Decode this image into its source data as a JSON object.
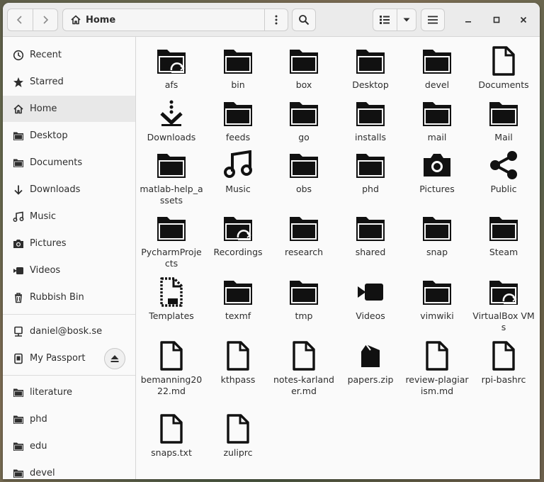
{
  "header": {
    "location": "Home",
    "icons": {
      "back": "chevron-left-icon",
      "forward": "chevron-right-icon",
      "home": "home-icon",
      "menu": "vertical-dots-icon",
      "search": "search-icon",
      "list_view": "list-view-icon",
      "view_options": "chevron-down-icon",
      "main_menu": "hamburger-icon",
      "minimize": "minimize-icon",
      "maximize": "maximize-icon",
      "close": "close-icon"
    }
  },
  "sidebar": {
    "places": [
      {
        "label": "Recent",
        "icon": "clock-icon"
      },
      {
        "label": "Starred",
        "icon": "star-icon"
      },
      {
        "label": "Home",
        "icon": "home-icon",
        "active": true
      },
      {
        "label": "Desktop",
        "icon": "folder-icon"
      },
      {
        "label": "Documents",
        "icon": "folder-icon"
      },
      {
        "label": "Downloads",
        "icon": "download-icon"
      },
      {
        "label": "Music",
        "icon": "music-icon"
      },
      {
        "label": "Pictures",
        "icon": "camera-icon"
      },
      {
        "label": "Videos",
        "icon": "video-icon"
      },
      {
        "label": "Rubbish Bin",
        "icon": "trash-icon"
      }
    ],
    "devices": [
      {
        "label": "daniel@bosk.se",
        "icon": "network-icon"
      },
      {
        "label": "My Passport",
        "icon": "drive-icon",
        "eject": true
      }
    ],
    "bookmarks": [
      {
        "label": "literature",
        "icon": "folder-icon"
      },
      {
        "label": "phd",
        "icon": "folder-icon"
      },
      {
        "label": "edu",
        "icon": "folder-icon"
      },
      {
        "label": "devel",
        "icon": "folder-icon"
      }
    ]
  },
  "files": [
    {
      "name": "afs",
      "icon": "folder-remote-icon"
    },
    {
      "name": "bin",
      "icon": "folder-icon"
    },
    {
      "name": "box",
      "icon": "folder-icon"
    },
    {
      "name": "Desktop",
      "icon": "folder-icon"
    },
    {
      "name": "devel",
      "icon": "folder-icon"
    },
    {
      "name": "Documents",
      "icon": "document-icon"
    },
    {
      "name": "Downloads",
      "icon": "download-icon"
    },
    {
      "name": "feeds",
      "icon": "folder-icon"
    },
    {
      "name": "go",
      "icon": "folder-icon"
    },
    {
      "name": "installs",
      "icon": "folder-icon"
    },
    {
      "name": "mail",
      "icon": "folder-icon"
    },
    {
      "name": "Mail",
      "icon": "folder-icon"
    },
    {
      "name": "matlab-help_assets",
      "icon": "folder-icon"
    },
    {
      "name": "Music",
      "icon": "music-icon"
    },
    {
      "name": "obs",
      "icon": "folder-icon"
    },
    {
      "name": "phd",
      "icon": "folder-icon"
    },
    {
      "name": "Pictures",
      "icon": "camera-icon"
    },
    {
      "name": "Public",
      "icon": "share-icon"
    },
    {
      "name": "PycharmProjects",
      "icon": "folder-icon"
    },
    {
      "name": "Recordings",
      "icon": "folder-remote-icon"
    },
    {
      "name": "research",
      "icon": "folder-icon"
    },
    {
      "name": "shared",
      "icon": "folder-icon"
    },
    {
      "name": "snap",
      "icon": "folder-icon"
    },
    {
      "name": "Steam",
      "icon": "folder-icon"
    },
    {
      "name": "Templates",
      "icon": "template-icon"
    },
    {
      "name": "texmf",
      "icon": "folder-icon"
    },
    {
      "name": "tmp",
      "icon": "folder-icon"
    },
    {
      "name": "Videos",
      "icon": "video-icon"
    },
    {
      "name": "vimwiki",
      "icon": "folder-icon"
    },
    {
      "name": "VirtualBox VMs",
      "icon": "folder-remote-icon"
    },
    {
      "name": "bemanning2022.md",
      "icon": "document-icon"
    },
    {
      "name": "kthpass",
      "icon": "document-icon"
    },
    {
      "name": "notes-karlander.md",
      "icon": "document-icon"
    },
    {
      "name": "papers.zip",
      "icon": "archive-icon"
    },
    {
      "name": "review-plagiarism.md",
      "icon": "document-icon"
    },
    {
      "name": "rpi-bashrc",
      "icon": "document-icon"
    },
    {
      "name": "snaps.txt",
      "icon": "document-icon"
    },
    {
      "name": "zuliprc",
      "icon": "document-icon"
    }
  ]
}
